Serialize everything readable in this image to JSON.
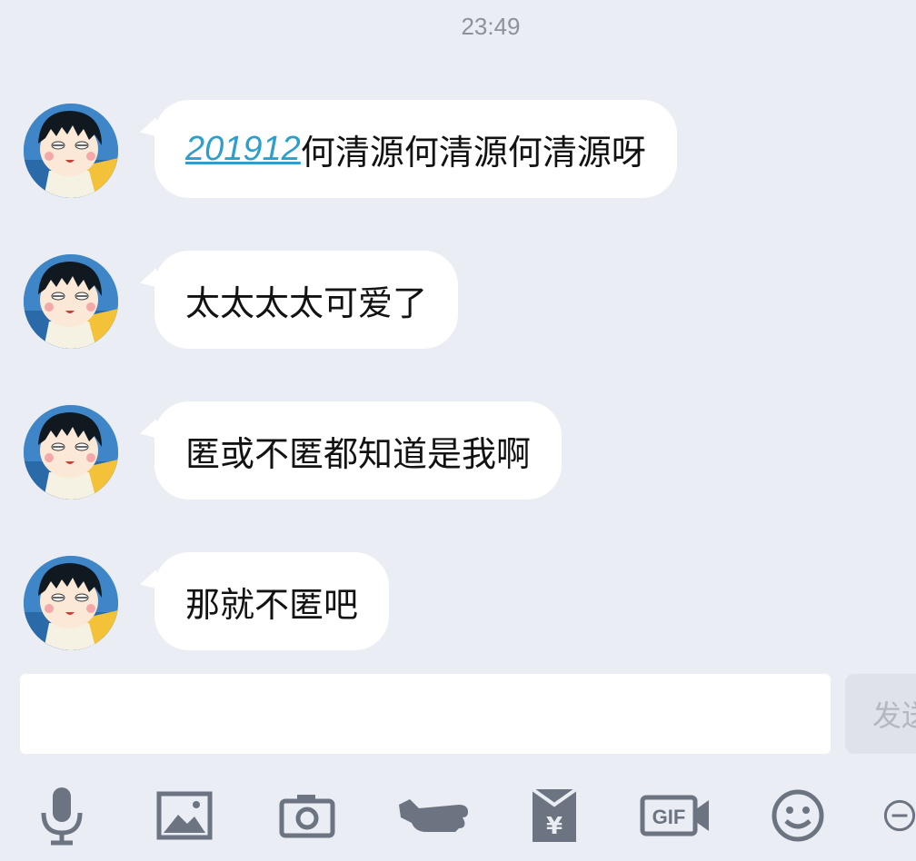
{
  "status": {
    "time": "23:49"
  },
  "chat": {
    "messages": [
      {
        "link": "201912",
        "text": "何清源何清源何清源呀"
      },
      {
        "text": "太太太太可爱了"
      },
      {
        "text": "匿或不匿都知道是我啊"
      },
      {
        "text": "那就不匿吧"
      }
    ]
  },
  "composer": {
    "input_value": "",
    "send_label": "发送"
  },
  "toolbar": {
    "icons": [
      "microphone-icon",
      "image-icon",
      "camera-icon",
      "poke-hand-icon",
      "red-packet-icon",
      "gif-icon",
      "emoji-icon",
      "add-icon"
    ],
    "gif_label": "GIF",
    "red_packet_label": "¥"
  },
  "colors": {
    "background": "#eaedf3",
    "bubble": "#ffffff",
    "link": "#2e9fca",
    "icon": "#6b7480"
  }
}
